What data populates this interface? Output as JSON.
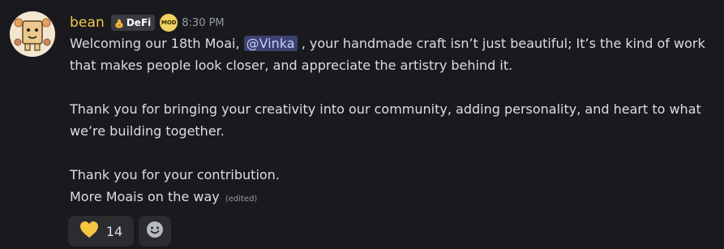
{
  "message": {
    "username": "bean",
    "role_tag": "DeFi",
    "mod_badge": "MOD",
    "timestamp": "8:30 PM",
    "line1_before": "Welcoming our 18th Moai, ",
    "mention": "@Vinka",
    "line1_after": " , your handmade craft isn’t just beautiful; It’s the kind of work that makes people look closer, and appreciate the artistry behind it.",
    "paragraph2": "Thank you for bringing your creativity into our community, adding personality, and heart to what we’re building together.",
    "paragraph3_line1": "Thank you for your contribution.",
    "paragraph3_line2": "More Moais on the way",
    "edited_label": "(edited)"
  },
  "reactions": [
    {
      "emoji": "yellow-heart",
      "count": "14"
    }
  ],
  "colors": {
    "background": "#1a1a1e",
    "username": "#f0c94a",
    "mention_bg": "#3c4270",
    "mention_text": "#c9cdfb",
    "reaction_bg": "#2b2b30",
    "heart": "#f5c542"
  }
}
